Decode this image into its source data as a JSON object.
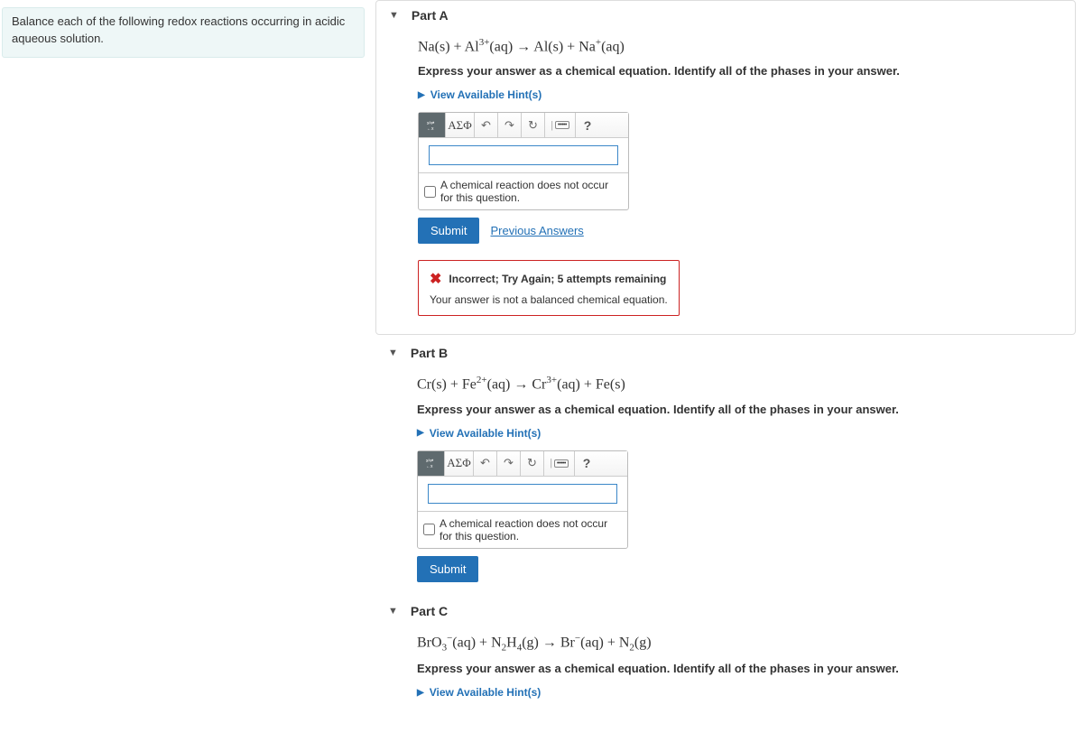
{
  "intro": "Balance each of the following redox reactions occurring in acidic aqueous solution.",
  "partA": {
    "title": "Part A",
    "equation_html": "Na(s) + Al<sup>3+</sup>(aq) → Al(s) + Na<sup>+</sup>(aq)",
    "instruction": "Express your answer as a chemical equation. Identify all of the phases in your answer.",
    "hints": "View Available Hint(s)",
    "greek": "ΑΣΦ",
    "help": "?",
    "no_occur": "A chemical reaction does not occur for this question.",
    "submit": "Submit",
    "prev": "Previous Answers",
    "feedback_title": "Incorrect; Try Again; 5 attempts remaining",
    "feedback_body": "Your answer is not a balanced chemical equation."
  },
  "partB": {
    "title": "Part B",
    "equation_html": "Cr(s) + Fe<sup>2+</sup>(aq) → Cr<sup>3+</sup>(aq) + Fe(s)",
    "instruction": "Express your answer as a chemical equation. Identify all of the phases in your answer.",
    "hints": "View Available Hint(s)",
    "greek": "ΑΣΦ",
    "help": "?",
    "no_occur": "A chemical reaction does not occur for this question.",
    "submit": "Submit"
  },
  "partC": {
    "title": "Part C",
    "equation_html": "BrO<sub>3</sub><sup>−</sup>(aq) + N<sub>2</sub>H<sub>4</sub>(g) → Br<sup>−</sup>(aq) + N<sub>2</sub>(g)",
    "instruction": "Express your answer as a chemical equation. Identify all of the phases in your answer.",
    "hints": "View Available Hint(s)"
  }
}
